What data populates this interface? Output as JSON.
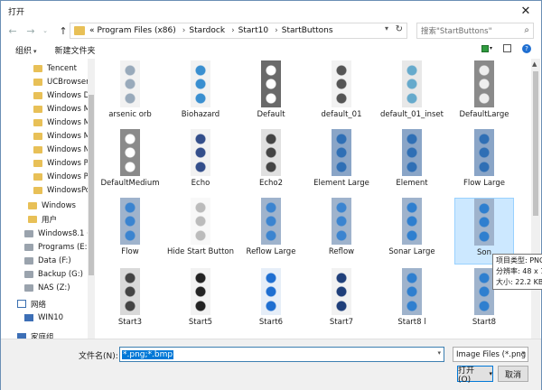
{
  "title": "打开",
  "address": {
    "crumbs": [
      "«",
      "Program Files (x86)",
      "Stardock",
      "Start10",
      "StartButtons"
    ]
  },
  "search": {
    "placeholder": "搜索\"StartButtons\""
  },
  "toolbar": {
    "organize": "组织",
    "new_folder": "新建文件夹"
  },
  "nav": {
    "items": [
      {
        "label": "Tencent",
        "kind": "folder"
      },
      {
        "label": "UCBrowser",
        "kind": "folder"
      },
      {
        "label": "Windows De",
        "kind": "folder"
      },
      {
        "label": "Windows M",
        "kind": "folder"
      },
      {
        "label": "Windows M",
        "kind": "folder"
      },
      {
        "label": "Windows M",
        "kind": "folder"
      },
      {
        "label": "Windows N",
        "kind": "folder"
      },
      {
        "label": "Windows Ph",
        "kind": "folder"
      },
      {
        "label": "Windows Po",
        "kind": "folder"
      },
      {
        "label": "WindowsPo",
        "kind": "folder"
      },
      {
        "label": "Windows",
        "kind": "folder"
      },
      {
        "label": "用户",
        "kind": "folder"
      },
      {
        "label": "Windows8.1 (D",
        "kind": "drive"
      },
      {
        "label": "Programs (E:)",
        "kind": "drive"
      },
      {
        "label": "Data (F:)",
        "kind": "drive"
      },
      {
        "label": "Backup (G:)",
        "kind": "drive"
      },
      {
        "label": "NAS (Z:)",
        "kind": "drive"
      },
      {
        "label": "网络",
        "kind": "network"
      },
      {
        "label": "WIN10",
        "kind": "pc"
      },
      {
        "label": "家庭组",
        "kind": "pc"
      }
    ]
  },
  "files": [
    {
      "label": "arsenic orb"
    },
    {
      "label": "Biohazard"
    },
    {
      "label": "Default"
    },
    {
      "label": "default_01"
    },
    {
      "label": "default_01_inset"
    },
    {
      "label": "DefaultLarge"
    },
    {
      "label": "DefaultMedium"
    },
    {
      "label": "Echo"
    },
    {
      "label": "Echo2"
    },
    {
      "label": "Element Large"
    },
    {
      "label": "Element"
    },
    {
      "label": "Flow Large"
    },
    {
      "label": "Flow"
    },
    {
      "label": "Hide Start Button"
    },
    {
      "label": "Reflow Large"
    },
    {
      "label": "Reflow"
    },
    {
      "label": "Sonar Large"
    },
    {
      "label": "Son"
    },
    {
      "label": "Start3"
    },
    {
      "label": "Start5"
    },
    {
      "label": "Start6"
    },
    {
      "label": "Start7"
    },
    {
      "label": "Start8 l"
    },
    {
      "label": "Start8"
    }
  ],
  "tooltip": {
    "line1": "项目类型: PNG",
    "line2": "分辨率: 48 x 1",
    "line3": "大小: 22.2 KB"
  },
  "bottom": {
    "filename_label": "文件名(N):",
    "filename_value": "*.png;*.bmp",
    "filter_value": "Image Files (*.png",
    "open_label": "打开(O)",
    "cancel_label": "取消"
  }
}
